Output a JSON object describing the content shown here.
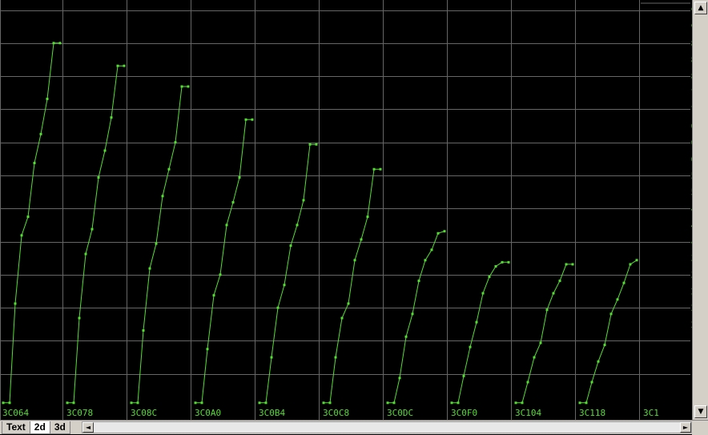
{
  "chart_data": {
    "type": "line",
    "color": "#55dd33",
    "grid_color": "#666666",
    "background": "#000000",
    "grid": true,
    "ylim": [
      0,
      97
    ],
    "y_ticks": [
      0,
      4,
      8,
      12,
      16,
      20,
      24,
      28,
      32,
      36,
      40,
      44,
      48,
      52,
      56,
      60,
      64,
      68,
      72,
      76,
      80,
      84,
      88,
      92,
      96
    ],
    "x_ticks": [
      "3C064",
      "3C078",
      "3C08C",
      "3C0A0",
      "3C0B4",
      "3C0C8",
      "3C0DC",
      "3C0F0",
      "3C104",
      "3C118",
      "3C1"
    ],
    "series": [
      {
        "values": [
          1,
          1,
          25,
          41.5,
          46,
          59,
          66,
          74.5,
          88,
          88
        ]
      },
      {
        "values": [
          1,
          1,
          21.5,
          37,
          43,
          55.5,
          62,
          70,
          82.5,
          82.5
        ]
      },
      {
        "values": [
          1,
          1,
          18.5,
          33.5,
          39.5,
          51,
          57.5,
          64,
          77.5,
          77.5
        ]
      },
      {
        "values": [
          1,
          1,
          14,
          27,
          32,
          44,
          49.5,
          55.5,
          69.5,
          69.5
        ]
      },
      {
        "values": [
          1,
          1,
          12,
          24,
          29.5,
          39,
          44,
          50,
          63.5,
          63.5
        ]
      },
      {
        "values": [
          1,
          1,
          12,
          21.5,
          25,
          35.5,
          40.5,
          46,
          57.5,
          57.5
        ]
      },
      {
        "values": [
          1,
          1,
          7,
          17,
          22.5,
          30.5,
          35.5,
          38,
          42,
          42.5
        ]
      },
      {
        "values": [
          1,
          1,
          7.5,
          14.5,
          20.5,
          27.5,
          31.5,
          34,
          35,
          35
        ]
      },
      {
        "values": [
          1,
          1,
          6,
          12,
          15.5,
          23.5,
          27.5,
          30.5,
          34.5,
          34.5
        ]
      },
      {
        "values": [
          1,
          1,
          6,
          11,
          15,
          22.5,
          26,
          30,
          34.5,
          35.5
        ]
      }
    ]
  },
  "tabs": [
    "Text",
    "2d",
    "3d"
  ],
  "icons": {
    "scroll_up": "▲",
    "scroll_down": "▼",
    "scroll_left": "◄",
    "scroll_right": "►"
  }
}
